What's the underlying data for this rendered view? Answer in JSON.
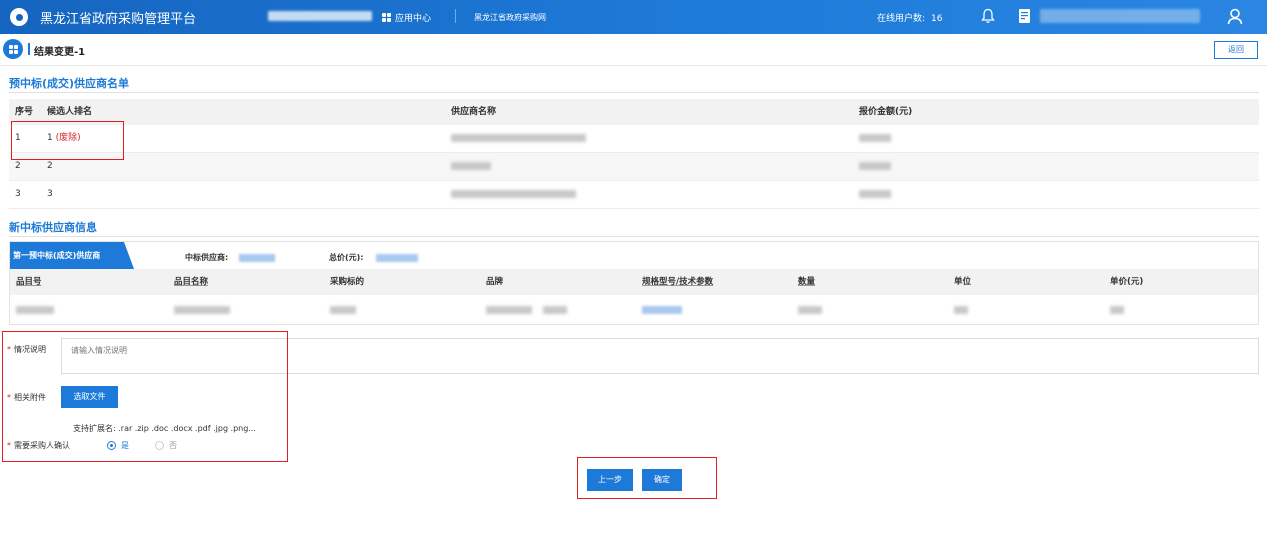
{
  "header": {
    "title": "黑龙江省政府采购管理平台",
    "app_center": "应用中心",
    "site_link": "黑龙江省政府采购网",
    "online_label": "在线用户数:",
    "online_count": "16"
  },
  "page": {
    "title": "结果变更-1",
    "back_label": "返回"
  },
  "ranking": {
    "section_title": "预中标(成交)供应商名单",
    "columns": [
      "序号",
      "候选人排名",
      "供应商名称",
      "报价金额(元)"
    ],
    "rows": [
      {
        "no": "1",
        "rank": "1",
        "tag": "(废除)"
      },
      {
        "no": "2",
        "rank": "2",
        "tag": ""
      },
      {
        "no": "3",
        "rank": "3",
        "tag": ""
      }
    ]
  },
  "supplier": {
    "section_title": "新中标供应商信息",
    "tab_label": "第一预中标(成交)供应商",
    "winner_label": "中标供应商:",
    "total_label": "总价(元):",
    "columns": [
      "品目号",
      "品目名称",
      "采购标的",
      "品牌",
      "规格型号/技术参数",
      "数量",
      "单位",
      "单价(元)"
    ]
  },
  "form": {
    "situation_label": "情况说明",
    "situation_placeholder": "请输入情况说明",
    "attachment_label": "相关附件",
    "choose_file_label": "选取文件",
    "extensions_text": "支持扩展名: .rar .zip .doc .docx .pdf .jpg .png...",
    "confirm_label": "需要采购人确认",
    "yes_label": "是",
    "no_label": "否",
    "prev_label": "上一步",
    "ok_label": "确定"
  },
  "colors": {
    "primary": "#1e7ad8",
    "highlight_box": "#e02020",
    "abolished_text": "#d9262a"
  }
}
